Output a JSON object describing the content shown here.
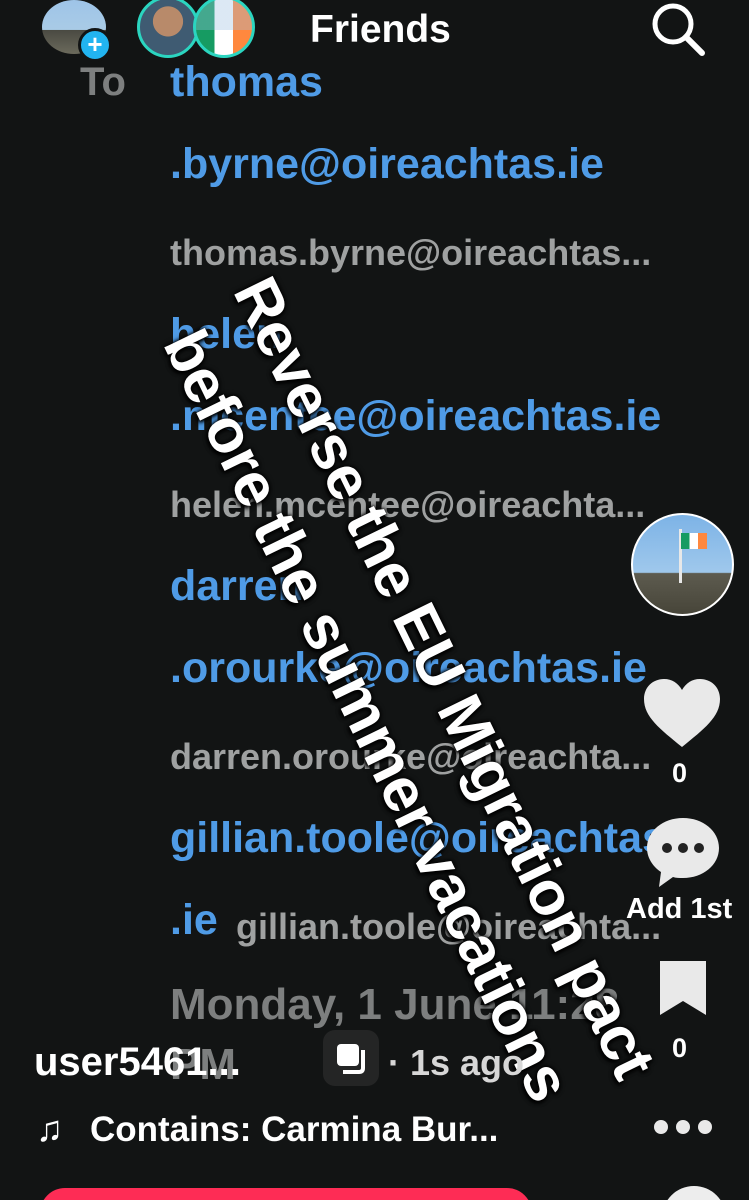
{
  "header": {
    "title": "Friends",
    "to_label": "To"
  },
  "email": {
    "recipients": [
      {
        "line1": "thomas",
        "line2": ".byrne@oireachtas.ie",
        "secondary": "thomas.byrne@oireachtas..."
      },
      {
        "line1": "helen",
        "line2": ".mcentee@oireachtas.ie",
        "secondary": "helen.mcentee@oireachta..."
      },
      {
        "line1": "darren",
        "line2": ".orourke@oireachtas.ie",
        "secondary": "darren.orourke@oireachta..."
      },
      {
        "line1": "gillian.toole@oireachtas",
        "line2": ".ie",
        "secondary": "gillian.toole@oireachta..."
      }
    ],
    "date_line1": "Monday, 1 June 11:28",
    "date_line2": "PM"
  },
  "overlay": {
    "line1": "Reverse the EU Migration pact",
    "line2": "before the summer vacations"
  },
  "actions": {
    "like_count": "0",
    "comment_label": "Add 1st",
    "save_count": "0"
  },
  "post": {
    "username": "user5461...",
    "timestamp": "· 1s ago",
    "music_note": "♫",
    "music": "Contains: Carmina Bur..."
  },
  "colors": {
    "background": "#121414",
    "link_blue": "#4f9be6",
    "friend_ring": "#2bd5c0",
    "accent_pink": "#fe2c55",
    "plus_badge": "#22b4f0"
  },
  "icons": [
    "plus-icon",
    "search-icon",
    "heart-icon",
    "comment-icon",
    "bookmark-icon",
    "repost-icon",
    "music-note-icon",
    "more-icon"
  ]
}
